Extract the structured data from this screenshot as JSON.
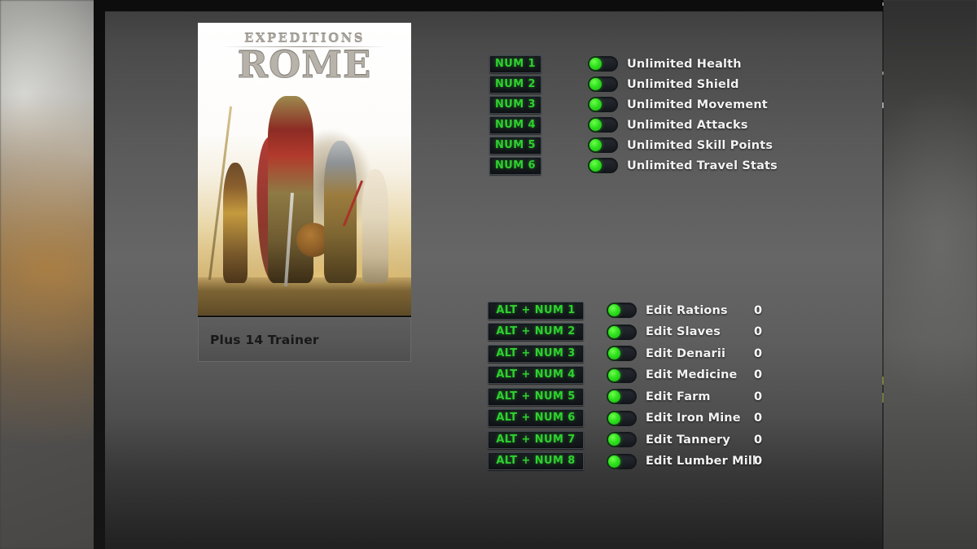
{
  "window": {
    "close_label": "close-icon"
  },
  "cover": {
    "game_title_line1": "EXPEDITIONS",
    "game_title_line2": "ROME",
    "trainer_title": "Plus 14 Trainer"
  },
  "colors": {
    "hotkey_text": "#2fd02f",
    "toggle_on": "#2fe01e",
    "label_text": "#f2f2f2",
    "panel_bg": "#666666",
    "hotkey_bg": "#15181c"
  },
  "options_top": [
    {
      "hotkey": "NUM 1",
      "label": "Unlimited Health",
      "enabled": true
    },
    {
      "hotkey": "NUM 2",
      "label": "Unlimited Shield",
      "enabled": true
    },
    {
      "hotkey": "NUM 3",
      "label": "Unlimited Movement",
      "enabled": true
    },
    {
      "hotkey": "NUM 4",
      "label": "Unlimited Attacks",
      "enabled": true
    },
    {
      "hotkey": "NUM 5",
      "label": "Unlimited Skill Points",
      "enabled": true
    },
    {
      "hotkey": "NUM 6",
      "label": "Unlimited Travel Stats",
      "enabled": true
    }
  ],
  "options_edit": [
    {
      "hotkey": "ALT + NUM 1",
      "label": "Edit Rations",
      "value": "0",
      "enabled": true
    },
    {
      "hotkey": "ALT + NUM 2",
      "label": "Edit Slaves",
      "value": "0",
      "enabled": true
    },
    {
      "hotkey": "ALT + NUM 3",
      "label": "Edit Denarii",
      "value": "0",
      "enabled": true
    },
    {
      "hotkey": "ALT + NUM 4",
      "label": "Edit Medicine",
      "value": "0",
      "enabled": true
    },
    {
      "hotkey": "ALT + NUM 5",
      "label": "Edit Farm",
      "value": "0",
      "enabled": true
    },
    {
      "hotkey": "ALT + NUM 6",
      "label": "Edit Iron Mine",
      "value": "0",
      "enabled": true
    },
    {
      "hotkey": "ALT + NUM 7",
      "label": "Edit Tannery",
      "value": "0",
      "enabled": true
    },
    {
      "hotkey": "ALT + NUM 8",
      "label": "Edit Lumber Mill",
      "value": "0",
      "enabled": true
    }
  ]
}
